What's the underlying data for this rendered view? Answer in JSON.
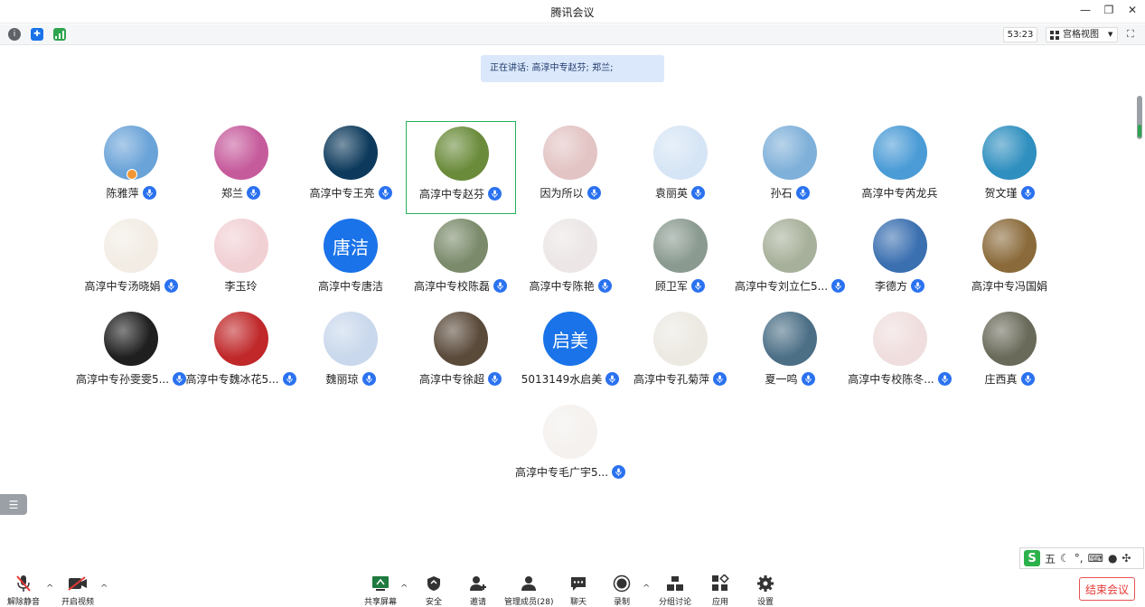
{
  "window": {
    "title": "腾讯会议",
    "min_icon": "minimize-icon",
    "restore_icon": "restore-icon",
    "close_icon": "close-icon"
  },
  "status": {
    "timer": "53:23",
    "view_label": "宫格视图"
  },
  "speaking": {
    "text": "正在讲话: 高淳中专赵芬; 郑兰;"
  },
  "participants": [
    {
      "name": "陈雅萍",
      "avatar_type": "photo",
      "bg": "#6aa3d8",
      "mic": true,
      "host": true,
      "active": false
    },
    {
      "name": "郑兰",
      "avatar_type": "photo",
      "bg": "#c65b9c",
      "mic": true,
      "host": false,
      "active": false
    },
    {
      "name": "高淳中专王亮",
      "avatar_type": "photo",
      "bg": "#0d3a5c",
      "mic": true,
      "host": false,
      "active": false
    },
    {
      "name": "高淳中专赵芬",
      "avatar_type": "photo",
      "bg": "#6a8b3a",
      "mic": true,
      "host": false,
      "active": true
    },
    {
      "name": "因为所以",
      "avatar_type": "photo",
      "bg": "#e3c4c4",
      "mic": true,
      "host": false,
      "active": false
    },
    {
      "name": "袁丽英",
      "avatar_type": "photo",
      "bg": "#d6e5f5",
      "mic": true,
      "host": false,
      "active": false
    },
    {
      "name": "孙石",
      "avatar_type": "photo",
      "bg": "#7fb0d9",
      "mic": true,
      "host": false,
      "active": false
    },
    {
      "name": "高淳中专芮龙兵",
      "avatar_type": "photo",
      "bg": "#4a9bd6",
      "mic": false,
      "host": false,
      "active": false
    },
    {
      "name": "贺文瑾",
      "avatar_type": "photo",
      "bg": "#2f8fbf",
      "mic": true,
      "host": false,
      "active": false
    },
    {
      "name": "高淳中专汤晓娟",
      "avatar_type": "photo",
      "bg": "#f2ece4",
      "mic": true,
      "host": false,
      "active": false
    },
    {
      "name": "李玉玲",
      "avatar_type": "photo",
      "bg": "#f1d0d4",
      "mic": false,
      "host": false,
      "active": false
    },
    {
      "name": "高淳中专唐洁",
      "avatar_type": "initial",
      "initial": "唐洁",
      "bg": "#1a73e8",
      "mic": false,
      "host": false,
      "active": false
    },
    {
      "name": "高淳中专校陈磊",
      "avatar_type": "photo",
      "bg": "#7a8a6a",
      "mic": true,
      "host": false,
      "active": false
    },
    {
      "name": "高淳中专陈艳",
      "avatar_type": "photo",
      "bg": "#ece6e6",
      "mic": true,
      "host": false,
      "active": false
    },
    {
      "name": "顾卫军",
      "avatar_type": "photo",
      "bg": "#8a9a90",
      "mic": true,
      "host": false,
      "active": false
    },
    {
      "name": "高淳中专刘立仁5...",
      "avatar_type": "photo",
      "bg": "#a7b09a",
      "mic": true,
      "host": false,
      "active": false
    },
    {
      "name": "李德方",
      "avatar_type": "photo",
      "bg": "#3a6fb0",
      "mic": true,
      "host": false,
      "active": false
    },
    {
      "name": "高淳中专冯国娟",
      "avatar_type": "photo",
      "bg": "#8a6a3a",
      "mic": false,
      "host": false,
      "active": false
    },
    {
      "name": "高淳中专孙雯雯5...",
      "avatar_type": "photo",
      "bg": "#1f1f1f",
      "mic": true,
      "host": false,
      "active": false
    },
    {
      "name": "高淳中专魏冰花5...",
      "avatar_type": "photo",
      "bg": "#c0282a",
      "mic": true,
      "host": false,
      "active": false
    },
    {
      "name": "魏丽琼",
      "avatar_type": "photo",
      "bg": "#c9d8ec",
      "mic": true,
      "host": false,
      "active": false
    },
    {
      "name": "高淳中专徐超",
      "avatar_type": "photo",
      "bg": "#5a4a3a",
      "mic": true,
      "host": false,
      "active": false
    },
    {
      "name": "5013149水启美",
      "avatar_type": "initial",
      "initial": "启美",
      "bg": "#1a73e8",
      "mic": true,
      "host": false,
      "active": false
    },
    {
      "name": "高淳中专孔菊萍",
      "avatar_type": "photo",
      "bg": "#ece9e2",
      "mic": true,
      "host": false,
      "active": false
    },
    {
      "name": "夏一鸣",
      "avatar_type": "photo",
      "bg": "#4c6f86",
      "mic": true,
      "host": false,
      "active": false
    },
    {
      "name": "高淳中专校陈冬...",
      "avatar_type": "photo",
      "bg": "#f0dede",
      "mic": true,
      "host": false,
      "active": false
    },
    {
      "name": "庄西真",
      "avatar_type": "photo",
      "bg": "#6a6a5a",
      "mic": true,
      "host": false,
      "active": false
    },
    {
      "name": "高淳中专毛广宇5...",
      "avatar_type": "photo",
      "bg": "#f4f1ee",
      "mic": true,
      "host": false,
      "active": false
    }
  ],
  "ime": {
    "mode": "五",
    "punct": "°,",
    "brand_letter": "S"
  },
  "toolbar": {
    "mute": "解除静音",
    "video": "开启视频",
    "share": "共享屏幕",
    "security": "安全",
    "invite": "邀请",
    "members": "管理成员(28)",
    "chat": "聊天",
    "record": "录制",
    "breakout": "分组讨论",
    "apps": "应用",
    "settings": "设置",
    "end": "结束会议"
  },
  "colors": {
    "accent": "#1a73e8",
    "active_border": "#27b05a",
    "end_red": "#e53935",
    "speaking_bg": "#dbe8fb"
  }
}
